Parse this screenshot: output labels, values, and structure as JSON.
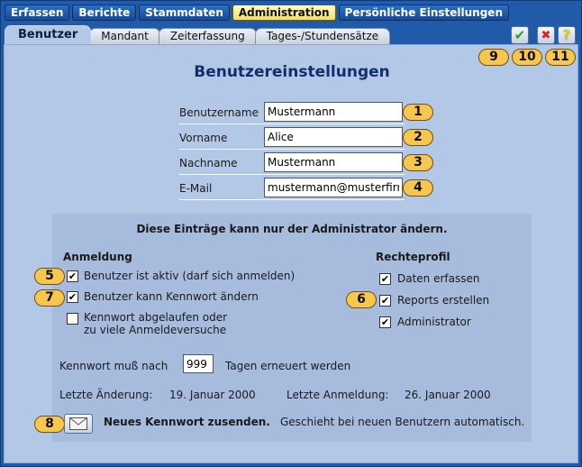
{
  "menu": {
    "items": [
      "Erfassen",
      "Berichte",
      "Stammdaten",
      "Administration",
      "Persönliche Einstellungen"
    ],
    "active_index": 3
  },
  "tabs": {
    "items": [
      "Benutzer",
      "Mandant",
      "Zeiterfassung",
      "Tages-/Stundensätze"
    ],
    "active_index": 0
  },
  "actions": {
    "save_glyph": "✔",
    "cancel_glyph": "✖",
    "help_glyph": "?",
    "badges": [
      "9",
      "10",
      "11"
    ]
  },
  "page": {
    "title": "Benutzereinstellungen"
  },
  "form": {
    "fields": [
      {
        "label": "Benutzername",
        "value": "Mustermann",
        "badge": "1"
      },
      {
        "label": "Vorname",
        "value": "Alice",
        "badge": "2"
      },
      {
        "label": "Nachname",
        "value": "Mustermann",
        "badge": "3"
      },
      {
        "label": "E-Mail",
        "value": "mustermann@musterfirm",
        "badge": "4"
      }
    ]
  },
  "admin": {
    "notice": "Diese Einträge kann nur der Administrator ändern.",
    "login": {
      "heading": "Anmeldung",
      "options": [
        {
          "label": "Benutzer ist aktiv (darf sich anmelden)",
          "checked": true,
          "badge": "5"
        },
        {
          "label": "Benutzer kann Kennwort ändern",
          "checked": true,
          "badge": "7"
        },
        {
          "label": "Kennwort abgelaufen oder",
          "label2": "zu viele Anmeldeversuche",
          "checked": false
        }
      ]
    },
    "rights": {
      "heading": "Rechteprofil",
      "badge": "6",
      "options": [
        {
          "label": "Daten erfassen",
          "checked": true
        },
        {
          "label": "Reports erstellen",
          "checked": true
        },
        {
          "label": "Administrator",
          "checked": true
        }
      ]
    },
    "password_renewal": {
      "prefix": "Kennwort muß nach",
      "days": "999",
      "suffix": "Tagen erneuert werden"
    },
    "last_change": {
      "label": "Letzte Änderung:",
      "value": "19. Januar 2000"
    },
    "last_login": {
      "label": "Letzte Anmeldung:",
      "value": "26. Januar 2000"
    },
    "new_password": {
      "badge": "8",
      "bold_text": "Neues Kennwort zusenden.",
      "text": "Geschieht bei neuen Benutzern automatisch."
    }
  },
  "colors": {
    "frame": "#1f5ba8",
    "panel": "#b3c7e6",
    "admin_box": "#a7bbdc",
    "badge": "#f7c64e",
    "title": "#10306a",
    "save": "#2ea01f",
    "cancel": "#d62222",
    "help": "#e8d000"
  }
}
